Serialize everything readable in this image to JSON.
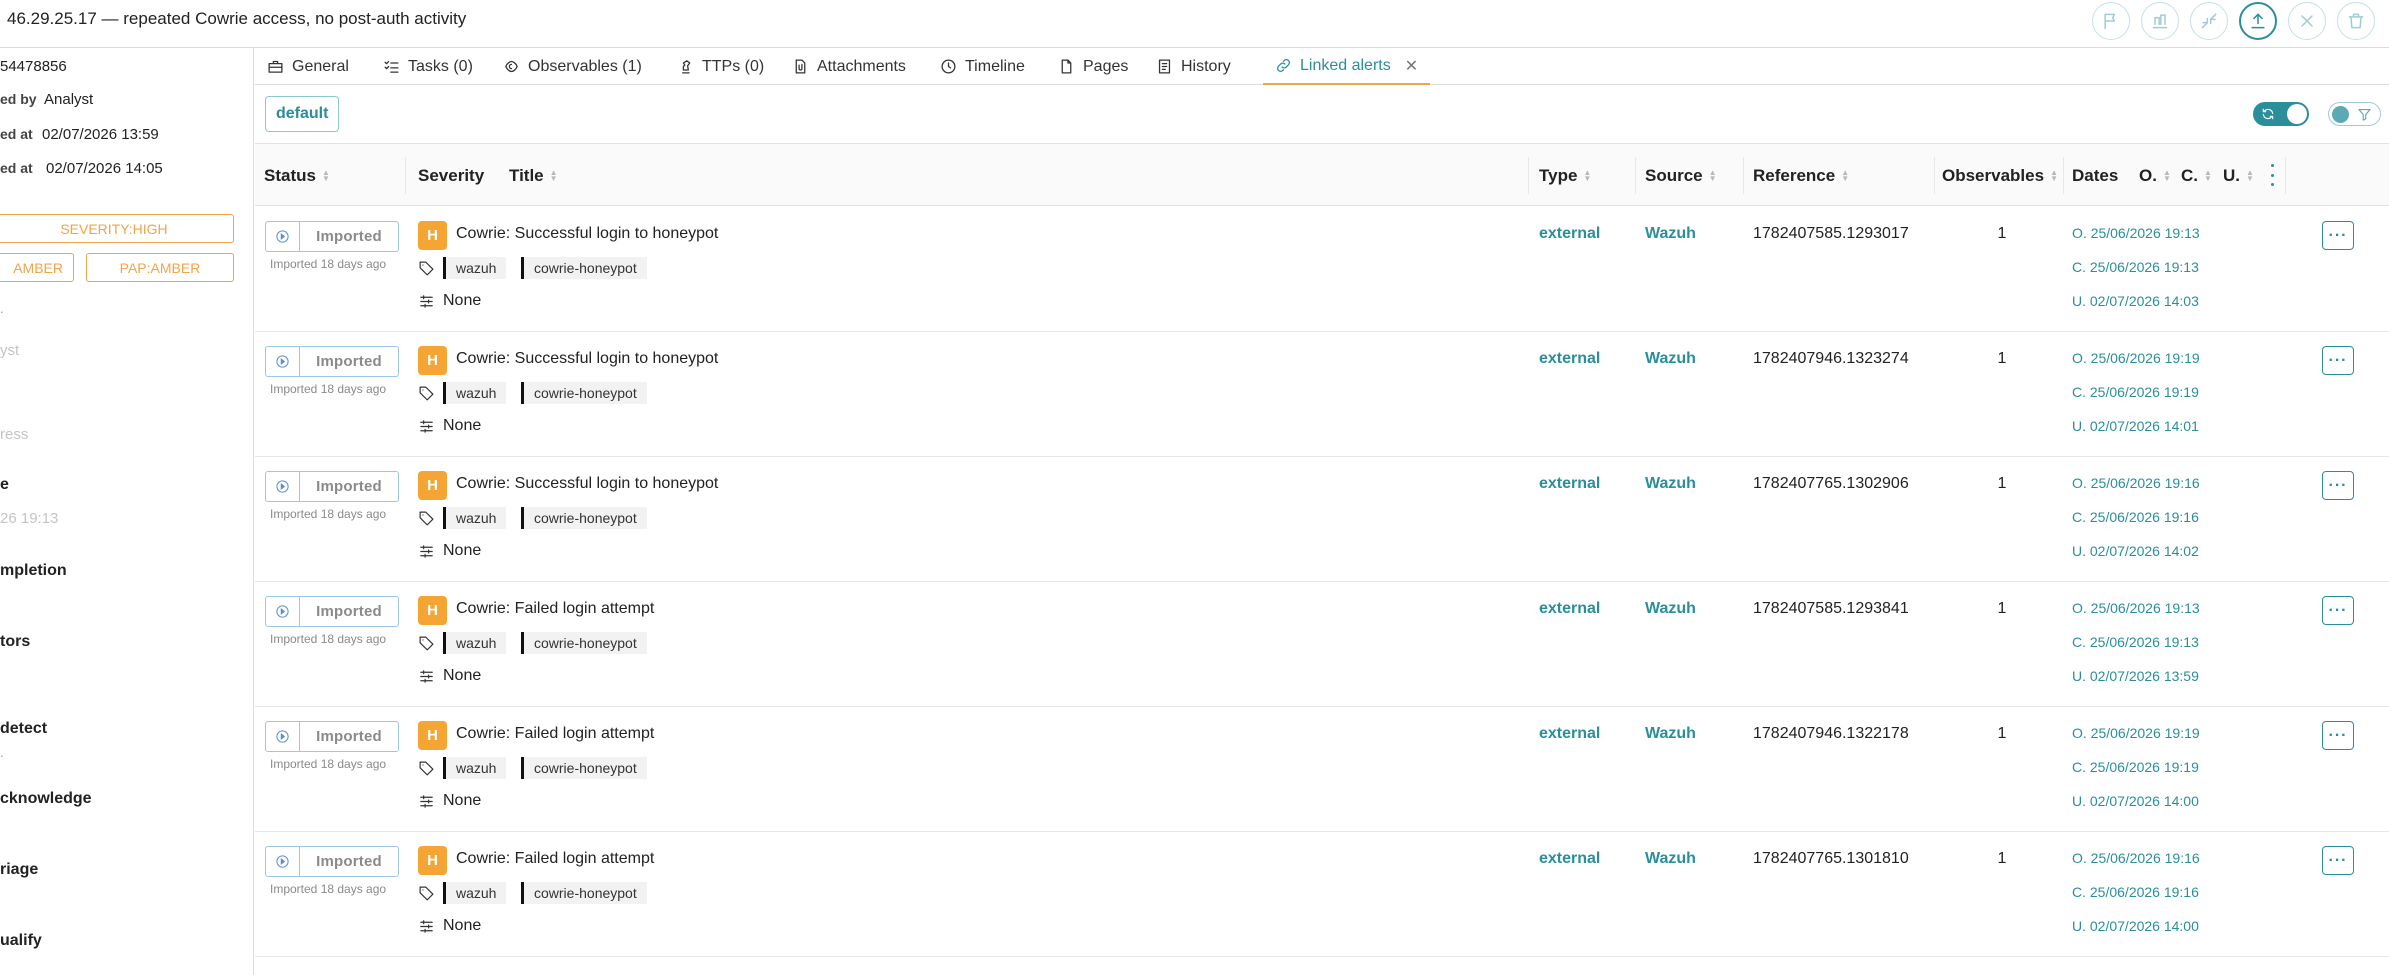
{
  "header": {
    "title": "46.29.25.17 — repeated Cowrie access, no post-auth activity",
    "actions": [
      {
        "name": "flag-icon"
      },
      {
        "name": "merge-icon"
      },
      {
        "name": "minimize-icon"
      },
      {
        "name": "export-icon"
      },
      {
        "name": "close-icon"
      },
      {
        "name": "trash-icon"
      }
    ]
  },
  "sidebar": {
    "case_number": "54478856",
    "created_by_label": "ed by",
    "created_by_value": "Analyst",
    "created_at_label": "ed at",
    "created_at_value": "02/07/2026 13:59",
    "updated_at_label": "ed at",
    "updated_at_value": "02/07/2026 14:05",
    "tags": {
      "severity": "SEVERITY:HIGH",
      "tlp": "AMBER",
      "pap": "PAP:AMBER"
    },
    "assignee_placeholder": "yst",
    "address_placeholder": "ress",
    "date_label": "e",
    "date_value": "26 19:13",
    "sections": [
      "mpletion",
      "tors",
      "detect",
      "cknowledge",
      "riage",
      "ualify"
    ]
  },
  "tabs": [
    {
      "label": "General",
      "icon": "briefcase-icon"
    },
    {
      "label": "Tasks (0)",
      "icon": "tasks-icon"
    },
    {
      "label": "Observables (1)",
      "icon": "observable-icon"
    },
    {
      "label": "TTPs (0)",
      "icon": "chess-icon"
    },
    {
      "label": "Attachments",
      "icon": "attachment-icon"
    },
    {
      "label": "Timeline",
      "icon": "clock-icon"
    },
    {
      "label": "Pages",
      "icon": "page-icon"
    },
    {
      "label": "History",
      "icon": "history-icon"
    },
    {
      "label": "Linked alerts",
      "icon": "link-icon"
    }
  ],
  "toolbar": {
    "filter_chip": "default"
  },
  "table": {
    "columns": {
      "status": "Status",
      "severity": "Severity",
      "title": "Title",
      "type": "Type",
      "source": "Source",
      "reference": "Reference",
      "observables": "Observables",
      "dates": "Dates",
      "date_o": "O.",
      "date_c": "C.",
      "date_u": "U."
    },
    "rows": [
      {
        "status": "Imported",
        "status_ago": "Imported 18 days ago",
        "severity": "H",
        "title": "Cowrie: Successful login to honeypot",
        "tags": [
          "wazuh",
          "cowrie-honeypot"
        ],
        "custom_fields": "None",
        "type": "external",
        "source": "Wazuh",
        "reference": "1782407585.1293017",
        "observables": "1",
        "date_o": "O. 25/06/2026 19:13",
        "date_c": "C. 25/06/2026 19:13",
        "date_u": "U. 02/07/2026 14:03"
      },
      {
        "status": "Imported",
        "status_ago": "Imported 18 days ago",
        "severity": "H",
        "title": "Cowrie: Successful login to honeypot",
        "tags": [
          "wazuh",
          "cowrie-honeypot"
        ],
        "custom_fields": "None",
        "type": "external",
        "source": "Wazuh",
        "reference": "1782407946.1323274",
        "observables": "1",
        "date_o": "O. 25/06/2026 19:19",
        "date_c": "C. 25/06/2026 19:19",
        "date_u": "U. 02/07/2026 14:01"
      },
      {
        "status": "Imported",
        "status_ago": "Imported 18 days ago",
        "severity": "H",
        "title": "Cowrie: Successful login to honeypot",
        "tags": [
          "wazuh",
          "cowrie-honeypot"
        ],
        "custom_fields": "None",
        "type": "external",
        "source": "Wazuh",
        "reference": "1782407765.1302906",
        "observables": "1",
        "date_o": "O. 25/06/2026 19:16",
        "date_c": "C. 25/06/2026 19:16",
        "date_u": "U. 02/07/2026 14:02"
      },
      {
        "status": "Imported",
        "status_ago": "Imported 18 days ago",
        "severity": "H",
        "title": "Cowrie: Failed login attempt",
        "tags": [
          "wazuh",
          "cowrie-honeypot"
        ],
        "custom_fields": "None",
        "type": "external",
        "source": "Wazuh",
        "reference": "1782407585.1293841",
        "observables": "1",
        "date_o": "O. 25/06/2026 19:13",
        "date_c": "C. 25/06/2026 19:13",
        "date_u": "U. 02/07/2026 13:59"
      },
      {
        "status": "Imported",
        "status_ago": "Imported 18 days ago",
        "severity": "H",
        "title": "Cowrie: Failed login attempt",
        "tags": [
          "wazuh",
          "cowrie-honeypot"
        ],
        "custom_fields": "None",
        "type": "external",
        "source": "Wazuh",
        "reference": "1782407946.1322178",
        "observables": "1",
        "date_o": "O. 25/06/2026 19:19",
        "date_c": "C. 25/06/2026 19:19",
        "date_u": "U. 02/07/2026 14:00"
      },
      {
        "status": "Imported",
        "status_ago": "Imported 18 days ago",
        "severity": "H",
        "title": "Cowrie: Failed login attempt",
        "tags": [
          "wazuh",
          "cowrie-honeypot"
        ],
        "custom_fields": "None",
        "type": "external",
        "source": "Wazuh",
        "reference": "1782407765.1301810",
        "observables": "1",
        "date_o": "O. 25/06/2026 19:16",
        "date_c": "C. 25/06/2026 19:16",
        "date_u": "U. 02/07/2026 14:00"
      }
    ]
  },
  "colors": {
    "accent": "#2a8f9b",
    "severity_high": "#f4a533",
    "amber": "#f0a54a",
    "status_border": "#9ec6e6"
  }
}
